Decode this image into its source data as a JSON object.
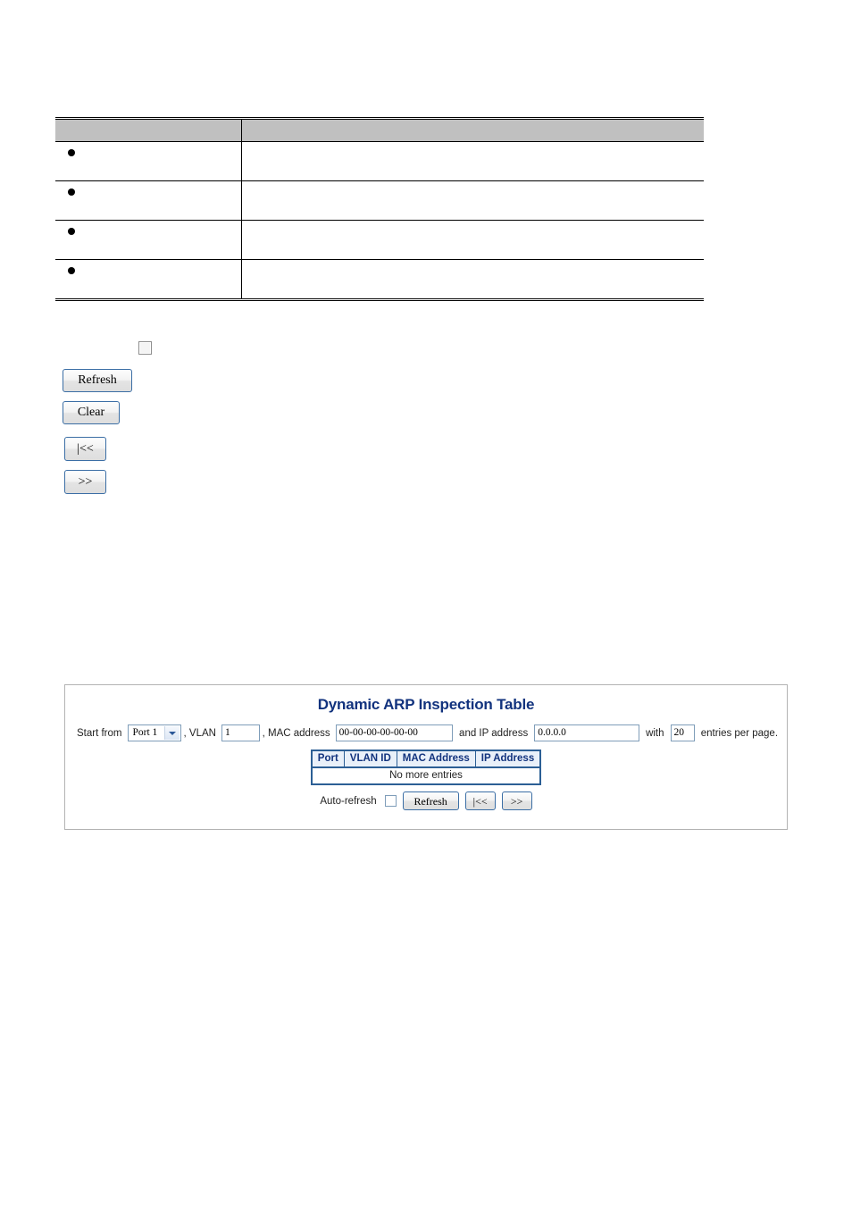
{
  "description_table": {
    "headers": {
      "object": "",
      "description": ""
    },
    "rows": [
      {
        "object": "",
        "description": ""
      },
      {
        "object": "",
        "description": ""
      },
      {
        "object": "",
        "description": ""
      },
      {
        "object": "",
        "description": ""
      }
    ]
  },
  "legend_controls": {
    "checkbox_label": "",
    "buttons": {
      "refresh": "Refresh",
      "clear": "Clear",
      "first": "|<<",
      "next": ">>"
    }
  },
  "arp_panel": {
    "title": "Dynamic ARP Inspection Table",
    "filter": {
      "start_from_label": "Start from",
      "port_value": "Port 1",
      "port_options": [
        "Port 1"
      ],
      "vlan_label": ", VLAN",
      "vlan_value": "1",
      "mac_label": ", MAC address",
      "mac_value": "00-00-00-00-00-00",
      "ip_label": "and IP address",
      "ip_value": "0.0.0.0",
      "with_label": "with",
      "entries_value": "20",
      "entries_suffix": "entries per page."
    },
    "results_table": {
      "columns": [
        "Port",
        "VLAN ID",
        "MAC Address",
        "IP Address"
      ],
      "rows": [],
      "empty_message": "No more entries"
    },
    "controls": {
      "autorefresh_label": "Auto-refresh",
      "autorefresh_checked": false,
      "refresh": "Refresh",
      "first": "|<<",
      "next": ">>"
    },
    "colors": {
      "title": "#12337e",
      "table_border": "#2c5f95",
      "header_bg": "#e9f0f9",
      "panel_border": "#b3b3b3"
    }
  }
}
